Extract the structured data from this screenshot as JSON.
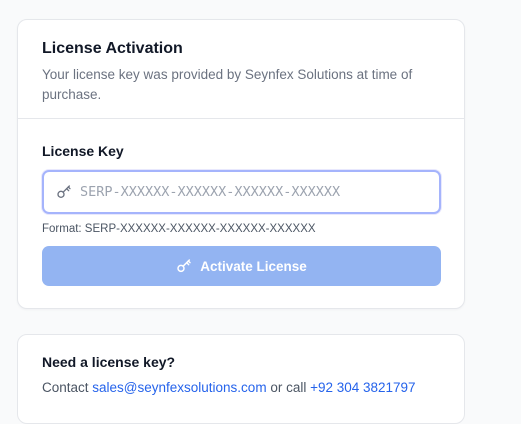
{
  "activation": {
    "title": "License Activation",
    "description": "Your license key was provided by Seynfex Solutions at time of purchase.",
    "field_label": "License Key",
    "input_placeholder": "SERP-XXXXXX-XXXXXX-XXXXXX-XXXXXX",
    "input_value": "",
    "format_hint": "Format: SERP-XXXXXX-XXXXXX-XXXXXX-XXXXXX",
    "button_label": "Activate License",
    "key_icon": "key-icon"
  },
  "help": {
    "title": "Need a license key?",
    "contact_prefix": "Contact ",
    "email": "sales@seynfexsolutions.com",
    "call_text": " or call ",
    "phone": "+92 304 3821797"
  },
  "colors": {
    "accent_disabled": "#93b4f2",
    "link": "#2563eb",
    "input_focus_border": "#a5b4fc"
  }
}
